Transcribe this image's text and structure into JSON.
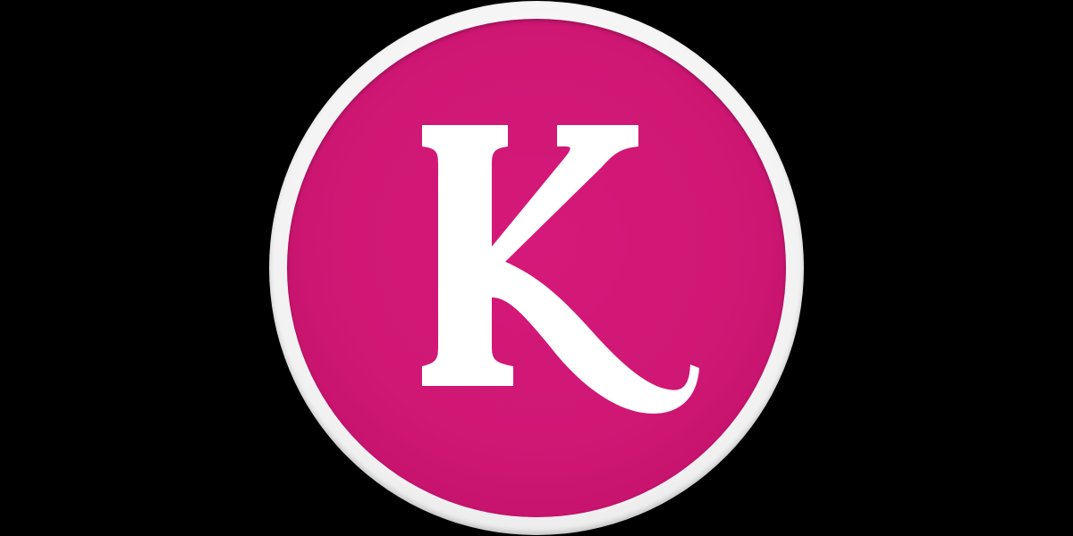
{
  "logo": {
    "name": "K",
    "colors": {
      "background": "#000000",
      "ring": "#f1f1f1",
      "disc": "#cf1774",
      "letter": "#ffffff"
    }
  }
}
